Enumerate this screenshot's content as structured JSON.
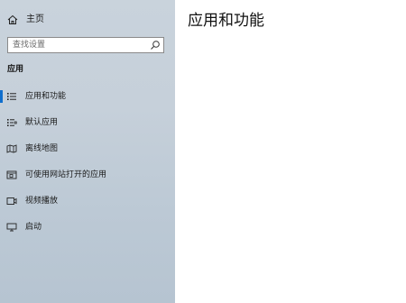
{
  "sidebar": {
    "home_label": "主页",
    "search": {
      "placeholder": "查找设置"
    },
    "section_title": "应用",
    "items": [
      {
        "label": "应用和功能",
        "icon": "apps-list-icon",
        "selected": true
      },
      {
        "label": "默认应用",
        "icon": "default-apps-icon",
        "selected": false
      },
      {
        "label": "离线地图",
        "icon": "map-icon",
        "selected": false
      },
      {
        "label": "可使用网站打开的应用",
        "icon": "open-in-app-icon",
        "selected": false
      },
      {
        "label": "视频播放",
        "icon": "video-icon",
        "selected": false
      },
      {
        "label": "启动",
        "icon": "startup-icon",
        "selected": false
      }
    ]
  },
  "main": {
    "title": "应用和功能"
  },
  "colors": {
    "accent": "#0f6ecd",
    "sidebar_bg": "#c6d0da"
  }
}
